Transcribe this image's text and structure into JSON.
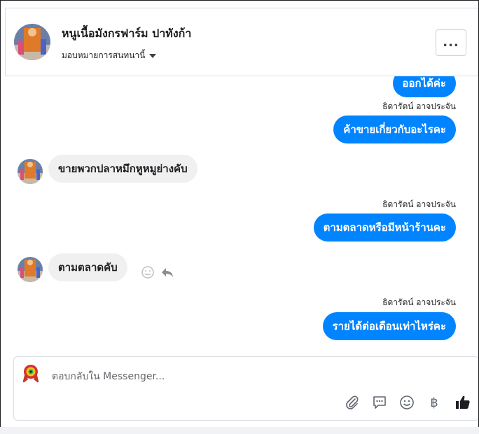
{
  "header": {
    "page_name": "หนูเนื้อมังกรฟาร์ม ปาทังก้า",
    "assign_label": "มอบหมายการสนทนานี้",
    "more_label": "..."
  },
  "messages": [
    {
      "direction": "out",
      "text": "ออกได้ค่ะ"
    },
    {
      "direction": "out",
      "sender": "ธิดารัตน์ อาจประจัน",
      "text": "ค้าขายเกี่ยวกับอะไรคะ"
    },
    {
      "direction": "in",
      "text": "ขายพวกปลาหมึกหูหมูย่างคับ"
    },
    {
      "direction": "out",
      "sender": "ธิดารัตน์ อาจประจัน",
      "text": "ตามตลาดหรือมีหน้าร้านคะ"
    },
    {
      "direction": "in",
      "text": "ตามตลาดคับ"
    },
    {
      "direction": "out",
      "sender": "ธิดารัตน์ อาจประจัน",
      "text": "รายได้ต่อเดือนเท่าไหร่คะ"
    }
  ],
  "composer": {
    "placeholder": "ตอบกลับใน Messenger...",
    "baht_symbol": "฿"
  },
  "colors": {
    "outgoing_bubble": "#0084ff",
    "incoming_bubble": "#f0f0f0",
    "like_icon": "#1c1e21"
  },
  "icons": [
    "more-icon",
    "caret-down-icon",
    "smiley-icon",
    "reply-icon",
    "attachment-icon",
    "saved-reply-icon",
    "emoji-icon",
    "baht-icon",
    "like-icon"
  ]
}
